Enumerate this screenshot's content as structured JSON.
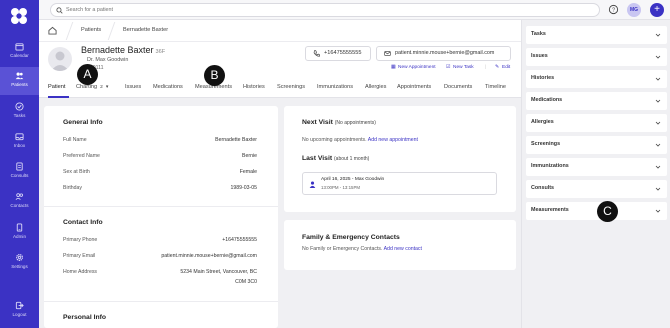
{
  "sidebar": {
    "items": [
      {
        "label": "Calendar",
        "icon": "calendar-icon"
      },
      {
        "label": "Patients",
        "icon": "patients-icon",
        "active": true
      },
      {
        "label": "Tasks",
        "icon": "tasks-icon"
      },
      {
        "label": "Inbox",
        "icon": "inbox-icon"
      },
      {
        "label": "Consults",
        "icon": "consults-icon"
      },
      {
        "label": "Contacts",
        "icon": "contacts-icon"
      },
      {
        "label": "Admin",
        "icon": "admin-icon"
      },
      {
        "label": "Settings",
        "icon": "settings-icon"
      }
    ],
    "logout": {
      "label": "Logout",
      "icon": "logout-icon"
    }
  },
  "topbar": {
    "search_placeholder": "Search for a patient",
    "user_initials": "MG",
    "add_label": "+"
  },
  "breadcrumb": {
    "items": [
      "Patients",
      "Bernadette Baxter"
    ]
  },
  "patient": {
    "name": "Bernadette Baxter",
    "age_sex": "36F",
    "doctor": "Dr. Max Goodwin",
    "id": "200111",
    "phone": "+16475555555",
    "email": "patient.minnie.mouse+bernie@gmail.com",
    "actions": {
      "new_appointment": "New Appointment",
      "new_task": "New Task",
      "edit": "Edit"
    }
  },
  "tabs": {
    "items": [
      "Patient",
      "Charting",
      "Issues",
      "Medications",
      "Measurements",
      "Histories",
      "Screenings",
      "Immunizations",
      "Allergies",
      "Appointments",
      "Documents",
      "Timeline"
    ],
    "charting_badge": "2",
    "active": "Patient"
  },
  "general_info": {
    "title": "General Info",
    "rows": [
      {
        "label": "Full Name",
        "value": "Bernadette Baxter"
      },
      {
        "label": "Preferred Name",
        "value": "Bernie"
      },
      {
        "label": "Sex at Birth",
        "value": "Female"
      },
      {
        "label": "Birthday",
        "value": "1989-03-05"
      }
    ]
  },
  "contact_info": {
    "title": "Contact Info",
    "rows": [
      {
        "label": "Primary Phone",
        "value": "+16475555555"
      },
      {
        "label": "Primary Email",
        "value": "patient.minnie.mouse+bernie@gmail.com"
      },
      {
        "label": "Home Address",
        "value": "5234 Main Street, Vancouver, BC",
        "value2": "C0M 3C0"
      }
    ]
  },
  "personal_info": {
    "title": "Personal Info"
  },
  "next_visit": {
    "title": "Next Visit",
    "subtitle": "(No appointments)",
    "empty_text": "No upcoming appointments.",
    "link": "Add new appointment"
  },
  "last_visit": {
    "title": "Last Visit",
    "subtitle": "(about 1 month)",
    "entry_title": "April 16, 2025 - Max Goodwin",
    "entry_time": "13:00PM - 13:15PM"
  },
  "family": {
    "title": "Family & Emergency Contacts",
    "empty_text": "No Family or Emergency Contacts.",
    "link": "Add new contact"
  },
  "right_panel": {
    "sections": [
      "Tasks",
      "Issues",
      "Histories",
      "Medications",
      "Allergies",
      "Screenings",
      "Immunizations",
      "Consults",
      "Measurements"
    ]
  },
  "markers": {
    "a": "A",
    "b": "B",
    "c": "C"
  },
  "colors": {
    "brand": "#3b32c4",
    "link": "#3b32c4"
  }
}
